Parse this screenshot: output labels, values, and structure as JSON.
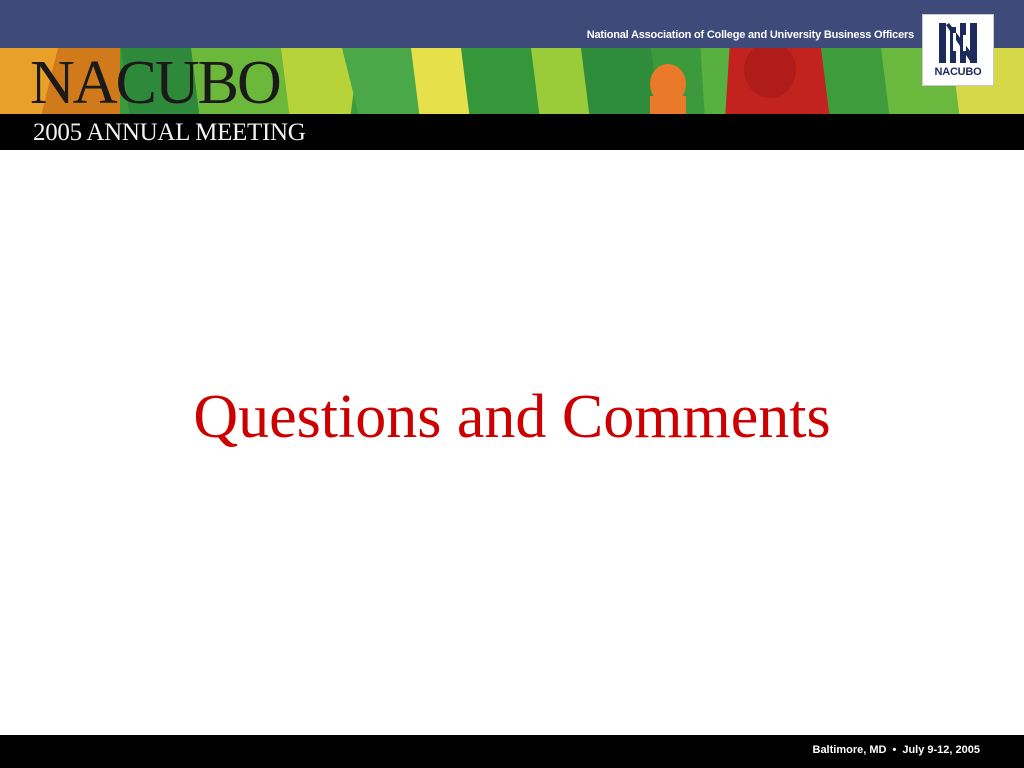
{
  "header": {
    "organization": "National Association of College and University Business Officers",
    "logo_text": "NACUBO",
    "title": "NACUBO",
    "subtitle": "2005 ANNUAL MEETING"
  },
  "slide": {
    "heading": "Questions and Comments"
  },
  "footer": {
    "location": "Baltimore, MD",
    "bullet": "•",
    "dates": "July 9-12, 2005"
  },
  "colors": {
    "heading": "#cc0000",
    "header_bar": "#3d4a7a",
    "logo_navy": "#1c2a5c",
    "footer_bar": "#000000"
  }
}
